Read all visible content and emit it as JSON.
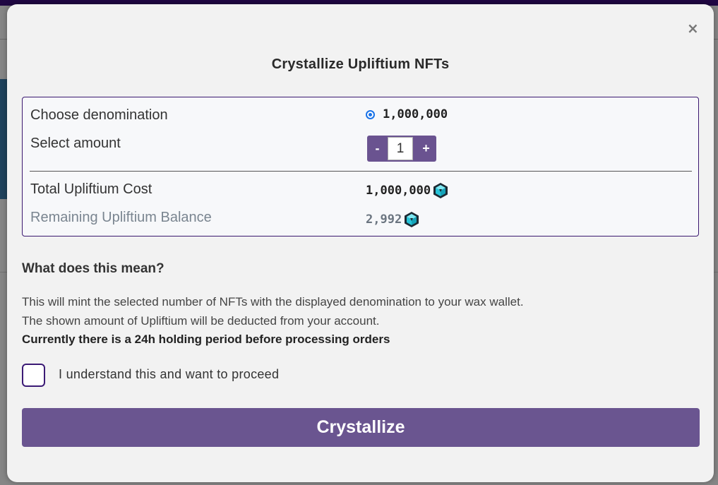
{
  "modal": {
    "close_symbol": "×",
    "title": "Crystallize Upliftium NFTs"
  },
  "form": {
    "denomination_label": "Choose denomination",
    "denomination_value": "1,000,000",
    "amount_label": "Select amount",
    "amount_minus": "-",
    "amount_value": "1",
    "amount_plus": "+",
    "total_cost_label": "Total Upliftium Cost",
    "total_cost_value": "1,000,000",
    "remaining_label": "Remaining Upliftium Balance",
    "remaining_value": "2,992",
    "currency_icon": "upliftium-gem-icon"
  },
  "info": {
    "heading": "What does this mean?",
    "line1": "This will mint the selected number of NFTs with the displayed denomination to your wax wallet.",
    "line2": "The shown amount of Upliftium will be deducted from your account.",
    "line3": "Currently there is a 24h holding period before processing orders"
  },
  "confirm": {
    "checkbox_label": "I understand this and want to proceed",
    "checked": false
  },
  "actions": {
    "crystallize_label": "Crystallize"
  },
  "colors": {
    "accent": "#6a5590",
    "border": "#3a1870",
    "radio": "#1a73e8",
    "gem": "#27c4d8"
  }
}
